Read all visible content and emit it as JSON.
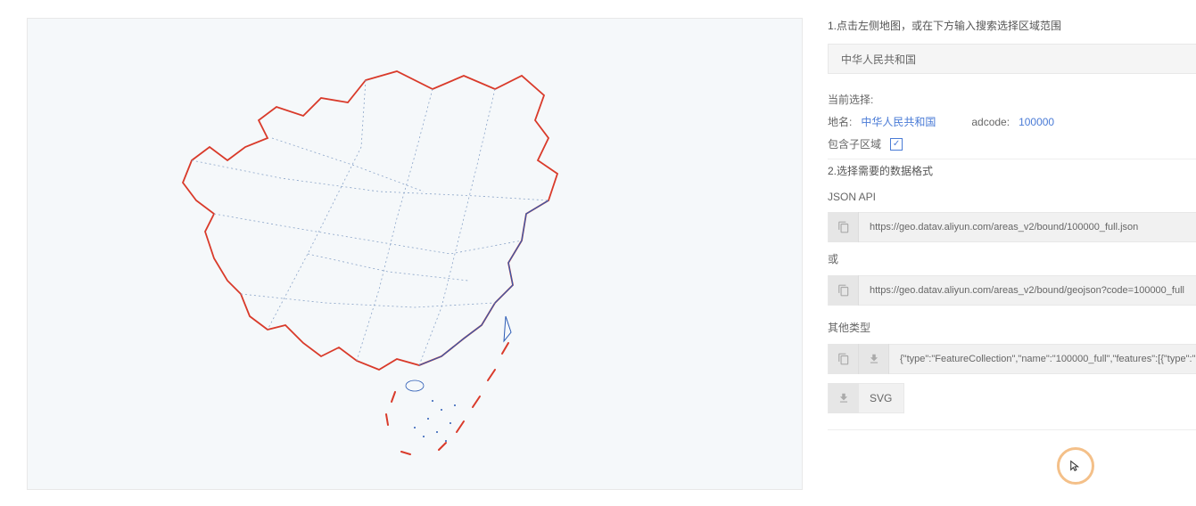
{
  "sidebar": {
    "step1_text": "1.点击左侧地图，或在下方输入搜索选择区域范围",
    "region_selector_value": "中华人民共和国",
    "current_selection_label": "当前选择:",
    "name_label": "地名:",
    "name_value": "中华人民共和国",
    "adcode_label": "adcode:",
    "adcode_value": "100000",
    "include_children_label": "包含子区域",
    "include_children_checked": true,
    "step2_text": "2.选择需要的数据格式",
    "json_api_label": "JSON API",
    "url1": "https://geo.datav.aliyun.com/areas_v2/bound/100000_full.json",
    "or_label": "或",
    "url2": "https://geo.datav.aliyun.com/areas_v2/bound/geojson?code=100000_full",
    "other_types_label": "其他类型",
    "geojson_snippet": "{\"type\":\"FeatureCollection\",\"name\":\"100000_full\",\"features\":[{\"type\":\"Feature\",\"prop",
    "svg_button_label": "SVG"
  }
}
